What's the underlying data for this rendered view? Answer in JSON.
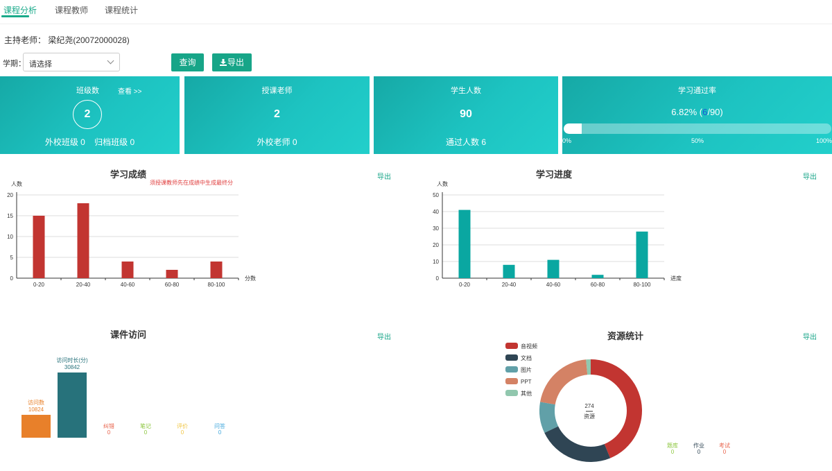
{
  "tabs": [
    {
      "label": "课程分析",
      "active": true
    },
    {
      "label": "课程教师",
      "active": false
    },
    {
      "label": "课程统计",
      "active": false
    }
  ],
  "host": {
    "text": "主持老师： 梁纪尧(20072000028)"
  },
  "filter": {
    "term_label": "学期：",
    "term_value": "请选择",
    "query_label": "查询",
    "export_label": "导出"
  },
  "cards": {
    "classes": {
      "title": "班级数",
      "link": "查看 >>",
      "value": "2",
      "foot": "外校班级 0    归档班级 0"
    },
    "teachers": {
      "title": "授课老师",
      "value": "2",
      "foot": "外校老师 0"
    },
    "students": {
      "title": "学生人数",
      "value": "90",
      "foot": "通过人数 6"
    },
    "pass_rate": {
      "title": "学习通过率",
      "rate": "6.82%",
      "passed": "6",
      "total": "/90)",
      "open": " (",
      "fraction": 0.0682,
      "labels": [
        "0%",
        "50%",
        "100%"
      ]
    }
  },
  "panels": {
    "score": {
      "title": "学习成绩",
      "export": "导出",
      "note": "须授课教师先在成绩中生成最终分"
    },
    "progress": {
      "title": "学习进度",
      "export": "导出"
    },
    "visits": {
      "title": "课件访问",
      "export": "导出"
    },
    "resources": {
      "title": "资源统计",
      "export": "导出"
    }
  },
  "colors": {
    "accent": "#17a588",
    "score_bar": "#c23531",
    "progress_bar": "#0aa7a1",
    "visits": "#e8802a",
    "duration": "#27727b"
  },
  "chart_data": [
    {
      "type": "bar",
      "title": "学习成绩",
      "ylabel": "人数",
      "xlabel": "分数",
      "categories": [
        "0-20",
        "20-40",
        "40-60",
        "60-80",
        "80-100"
      ],
      "values": [
        15,
        18,
        4,
        2,
        4
      ],
      "ylim": [
        0,
        20
      ],
      "yticks": [
        0,
        5,
        10,
        15,
        20
      ],
      "grid": true
    },
    {
      "type": "bar",
      "title": "学习进度",
      "ylabel": "人数",
      "xlabel": "进度",
      "categories": [
        "0-20",
        "20-40",
        "40-60",
        "60-80",
        "80-100"
      ],
      "values": [
        41,
        8,
        11,
        2,
        28
      ],
      "ylim": [
        0,
        50
      ],
      "yticks": [
        0,
        10,
        20,
        30,
        40,
        50
      ],
      "grid": true
    },
    {
      "type": "bar",
      "title": "课件访问",
      "series": [
        {
          "name": "访问数",
          "value": 10824,
          "value_label": "10824",
          "color": "#e8802a"
        },
        {
          "name": "访问时长(分)",
          "value": 30842,
          "value_label": "30842",
          "color": "#27727b"
        },
        {
          "name": "纠错",
          "value": 0,
          "value_label": "0",
          "color": "#e8624a"
        },
        {
          "name": "笔记",
          "value": 0,
          "value_label": "0",
          "color": "#8cc63e"
        },
        {
          "name": "评价",
          "value": 0,
          "value_label": "0",
          "color": "#f0c645"
        },
        {
          "name": "问答",
          "value": 0,
          "value_label": "0",
          "color": "#3fa7dc"
        }
      ]
    },
    {
      "type": "pie",
      "title": "资源统计",
      "center_value": "274",
      "center_label": "资源",
      "legend_position": "top-left",
      "slices": [
        {
          "name": "音视频",
          "value": 120,
          "color": "#c23531"
        },
        {
          "name": "文档",
          "value": 66,
          "color": "#2f4554"
        },
        {
          "name": "图片",
          "value": 27,
          "color": "#61a0a8"
        },
        {
          "name": "PPT",
          "value": 57,
          "color": "#d48265"
        },
        {
          "name": "其他",
          "value": 4,
          "color": "#91c7ae"
        }
      ],
      "extras": [
        {
          "name": "题库",
          "value": "0",
          "color": "#8cc63e"
        },
        {
          "name": "作业",
          "value": "0",
          "color": "#2f4554"
        },
        {
          "name": "考试",
          "value": "0",
          "color": "#e8624a"
        }
      ]
    }
  ]
}
